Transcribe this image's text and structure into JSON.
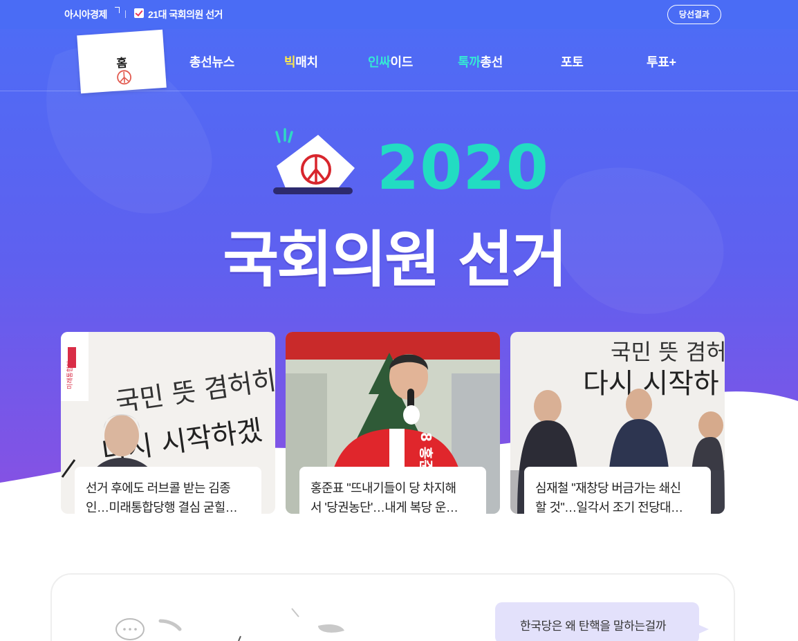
{
  "topbar": {
    "brand": "아시아경제",
    "title": "21대 국회의원 선거",
    "results_button": "당선결과"
  },
  "nav": {
    "home_label": "홈",
    "items": [
      {
        "label": "총선뉴스"
      },
      {
        "highlight": "빅",
        "rest": "매치",
        "highlight_color": "#ffe94a"
      },
      {
        "highlight": "인싸",
        "rest": "이드",
        "highlight_color": "#35e8d5"
      },
      {
        "highlight": "톡까",
        "rest": "총선",
        "highlight_color": "#35e8d5"
      },
      {
        "label": "포토"
      },
      {
        "label": "투표+"
      }
    ]
  },
  "hero": {
    "year": "2020",
    "title": "국회의원 선거",
    "colors": {
      "bg_top": "#4a6cf5",
      "bg_bottom": "#7b52e6",
      "year": "#22dcc2",
      "stamp": "#d8262d"
    }
  },
  "news_cards": [
    {
      "line1": "선거 후에도 러브콜 받는 김종",
      "line2": "인…미래통합당행 결심 굳힐…"
    },
    {
      "line1": "홍준표 \"뜨내기들이 당 차지해",
      "line2": "서 '당권농단'…내게 복당 운…"
    },
    {
      "line1": "심재철 \"재창당 버금가는 쇄신",
      "line2": "할 것\"…일각서 조기 전당대…"
    }
  ],
  "card_photos": {
    "card1_sign_line1": "국민 뜻 겸허히",
    "card1_sign_line2": "다시 시작하겠",
    "card1_party_mark": "미래통합당",
    "card2_banner": "8 홍준표",
    "card3_sign_line1": "국민 뜻 겸허",
    "card3_sign_line2": "다시 시작하"
  },
  "bottom": {
    "chat_text": "한국당은 왜 탄핵을 말하는걸까"
  },
  "icons": [
    "external-link-icon",
    "checkbox-icon",
    "ballot-stamp-icon",
    "ballot-box-icon",
    "speech-bubble-icon"
  ]
}
